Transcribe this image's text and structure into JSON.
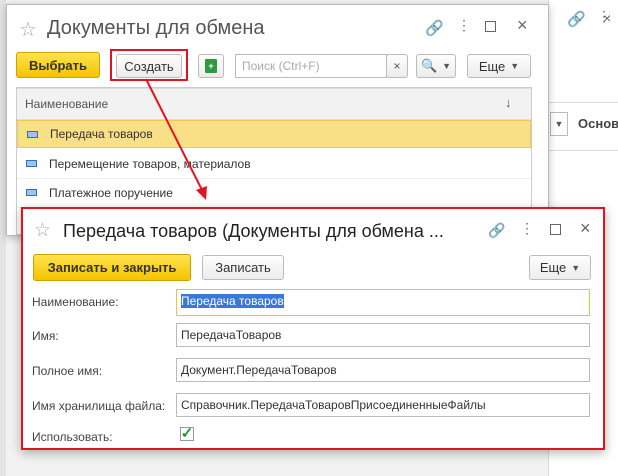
{
  "list_window": {
    "title": "Документы для обмена",
    "select_label": "Выбрать",
    "create_label": "Создать",
    "search_placeholder": "Поиск (Ctrl+F)",
    "search_clear": "×",
    "more_label": "Еще",
    "column_header": "Наименование",
    "sort_arrow": "↓",
    "rows": [
      {
        "label": "Передача товаров",
        "selected": true
      },
      {
        "label": "Перемещение товаров, материалов",
        "selected": false
      },
      {
        "label": "Платежное поручение",
        "selected": false
      }
    ]
  },
  "background": {
    "right_label": "Основ"
  },
  "form_window": {
    "title": "Передача товаров (Документы для обмена ...",
    "save_close_label": "Записать и закрыть",
    "save_label": "Записать",
    "more_label": "Еще",
    "fields": [
      {
        "label": "Наименование:",
        "value": "Передача товаров"
      },
      {
        "label": "Имя:",
        "value": "ПередачаТоваров"
      },
      {
        "label": "Полное имя:",
        "value": "Документ.ПередачаТоваров"
      },
      {
        "label": "Имя хранилища файла:",
        "value": "Справочник.ПередачаТоваровПрисоединенныеФайлы"
      }
    ],
    "use_label": "Использовать:",
    "use_checked": true
  },
  "colors": {
    "accent_yellow": "#f4c400",
    "highlight_red": "#e0151f",
    "selection_blue": "#3a78d8"
  }
}
